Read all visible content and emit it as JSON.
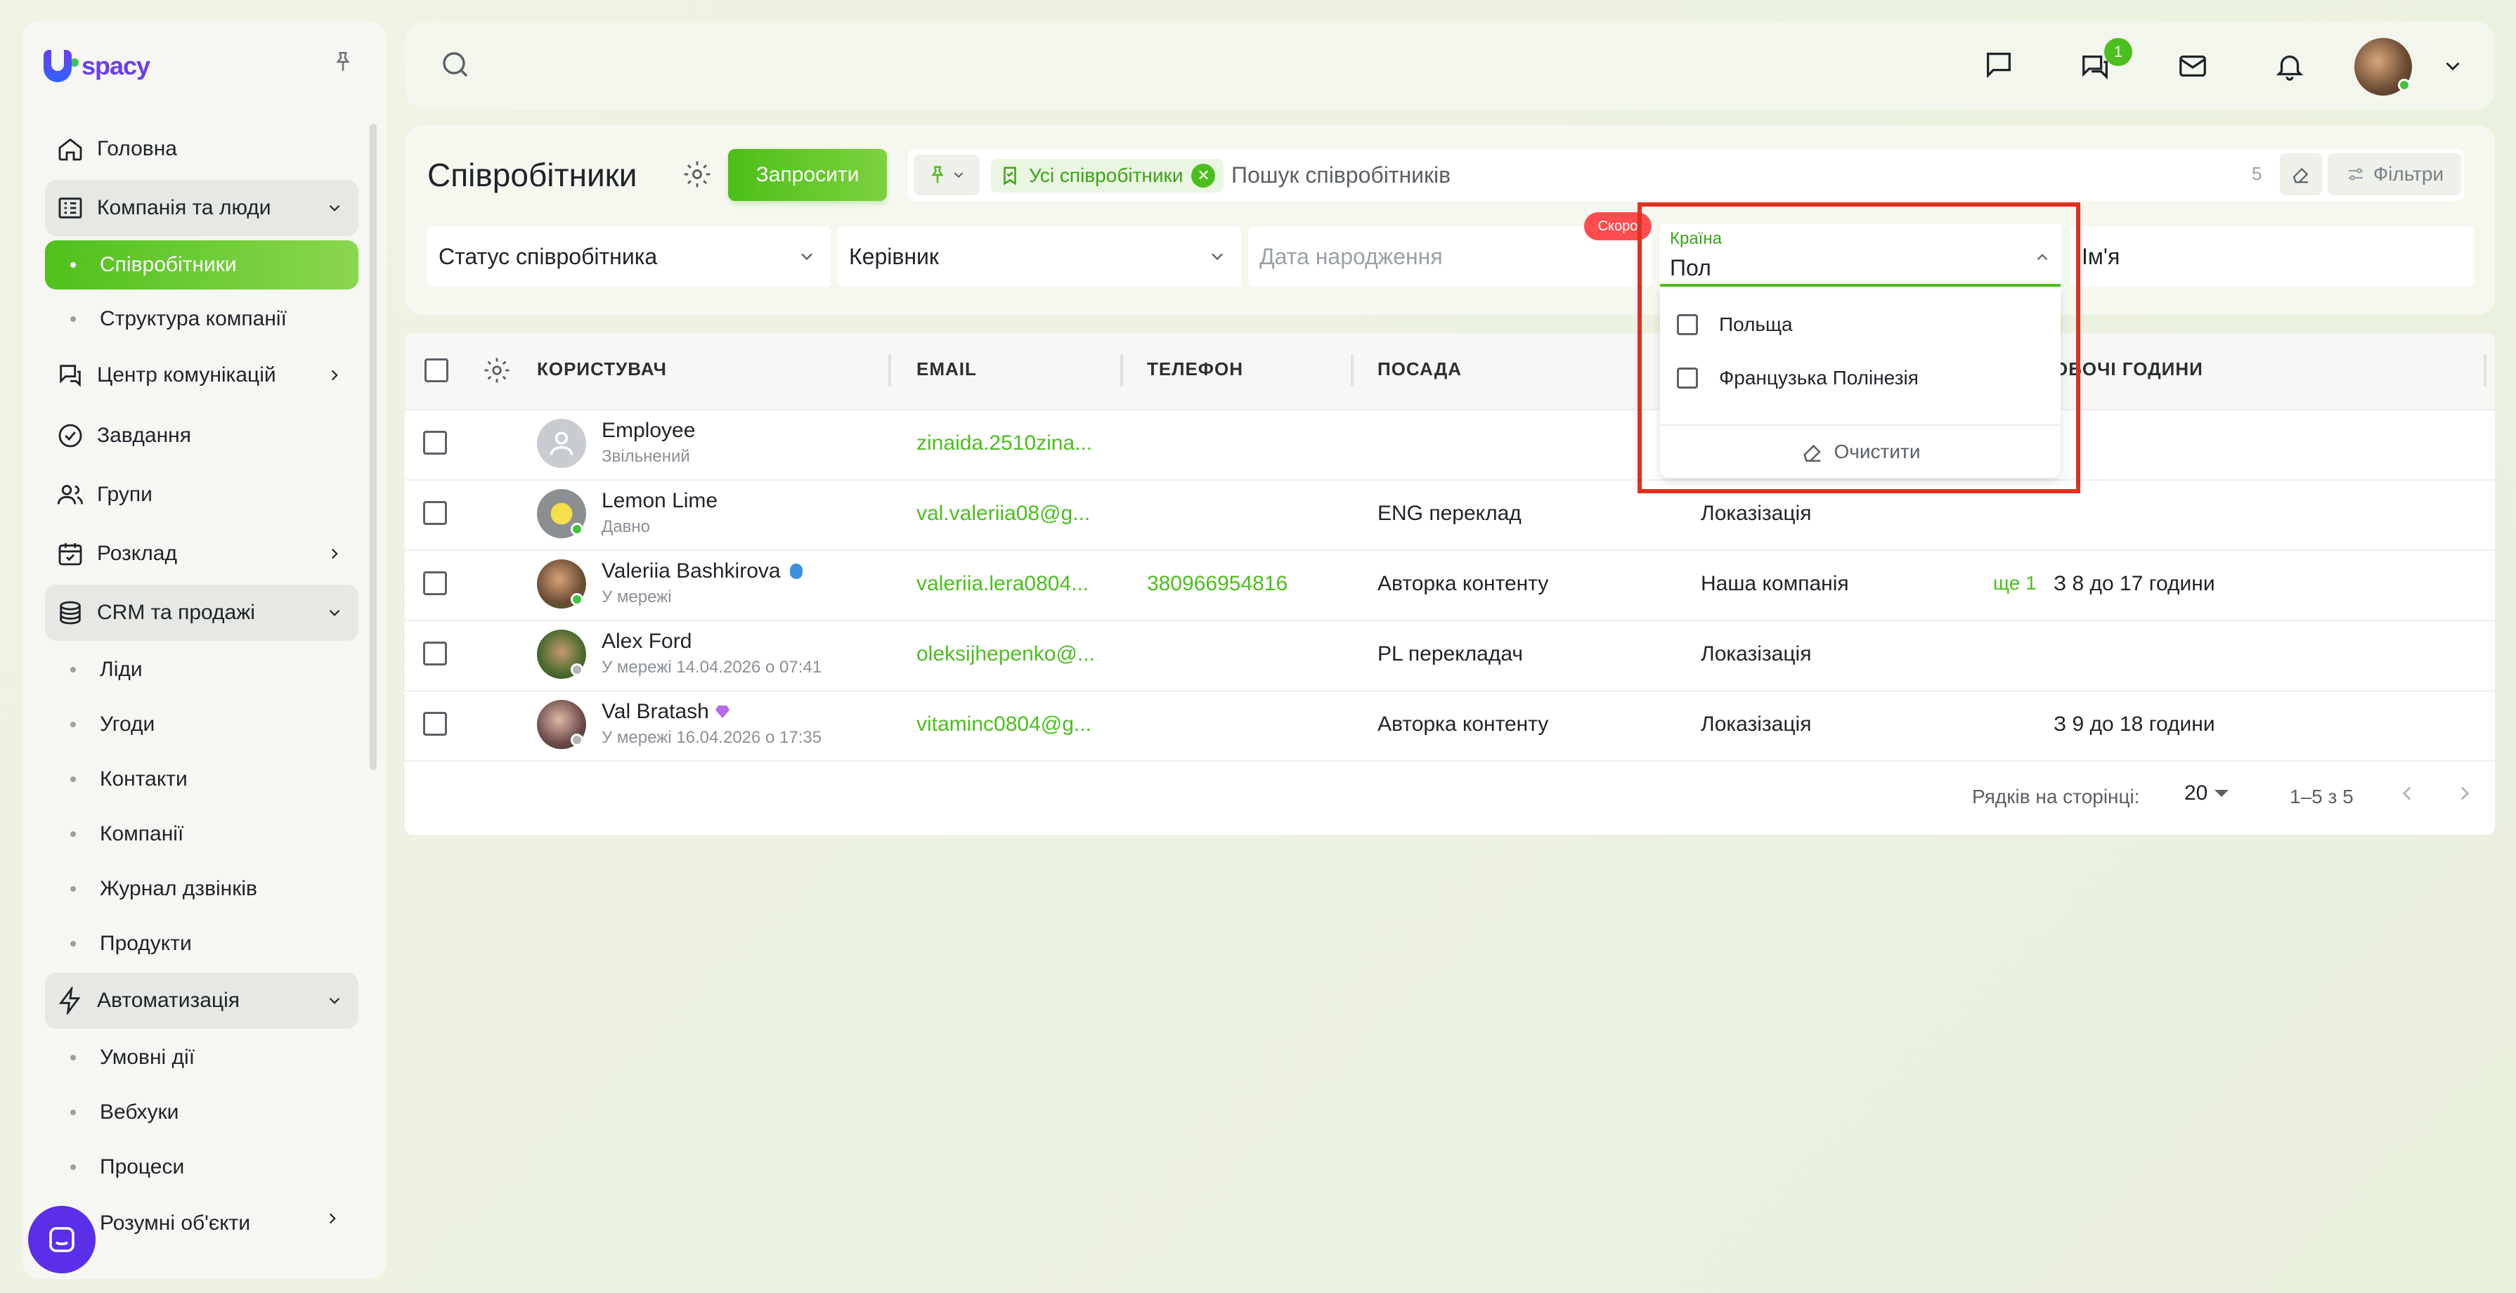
{
  "app": {
    "logo_text": "spacy"
  },
  "colors": {
    "brand_green": "#4cbe1d",
    "brand_purple": "#6a3df0",
    "highlight_red": "#e12f1f"
  },
  "sidebar": {
    "items": [
      {
        "label": "Головна",
        "icon": "home-icon"
      },
      {
        "label": "Компанія та люди",
        "icon": "company-icon",
        "expanded": true
      },
      {
        "label": "Співробітники",
        "sub": true,
        "active": true
      },
      {
        "label": "Структура компанії",
        "sub": true
      },
      {
        "label": "Центр комунікацій",
        "icon": "communication-icon"
      },
      {
        "label": "Завдання",
        "icon": "tasks-icon"
      },
      {
        "label": "Групи",
        "icon": "groups-icon"
      },
      {
        "label": "Розклад",
        "icon": "calendar-icon"
      },
      {
        "label": "CRM та продажі",
        "icon": "crm-icon",
        "expanded": true
      },
      {
        "label": "Ліди",
        "sub": true
      },
      {
        "label": "Угоди",
        "sub": true
      },
      {
        "label": "Контакти",
        "sub": true
      },
      {
        "label": "Компанії",
        "sub": true
      },
      {
        "label": "Журнал дзвінків",
        "sub": true
      },
      {
        "label": "Продукти",
        "sub": true
      },
      {
        "label": "Автоматизація",
        "icon": "automation-icon",
        "expanded": true
      },
      {
        "label": "Умовні дії",
        "sub": true
      },
      {
        "label": "Вебхуки",
        "sub": true
      },
      {
        "label": "Процеси",
        "sub": true
      },
      {
        "label": "Розумні об'єкти",
        "sub": true
      }
    ]
  },
  "topbar": {
    "chat_badge": "1"
  },
  "page": {
    "title": "Співробітники",
    "invite_label": "Запросити",
    "chip_label": "Усі співробітники",
    "search_placeholder": "Пошук співробітників",
    "result_count": "5",
    "filters_label": "Фільтри"
  },
  "filters": {
    "status": "Статус співробітника",
    "manager": "Керівник",
    "birthdate_placeholder": "Дата народження",
    "soon_badge": "Скоро",
    "country_label": "Країна",
    "country_value": "Пол",
    "name": "Ім'я"
  },
  "country_dropdown": {
    "options": [
      "Польща",
      "Французька Полінезія"
    ],
    "clear_label": "Очистити"
  },
  "table": {
    "headers": {
      "user": "КОРИСТУВАЧ",
      "email": "EMAIL",
      "phone": "ТЕЛЕФОН",
      "position": "ПОСАДА",
      "hours": "ОБОЧІ ГОДИНИ"
    },
    "rows": [
      {
        "name": "Employee",
        "status": "Звільнений",
        "email": "zinaida.2510zina...",
        "phone": "",
        "position": "",
        "department": "",
        "more": "",
        "hours": ""
      },
      {
        "name": "Lemon Lime",
        "status": "Давно",
        "email": "val.valeriia08@g...",
        "phone": "",
        "position": "ENG переклад",
        "department": "Локазізація",
        "more": "",
        "hours": ""
      },
      {
        "name": "Valeriia Bashkirova",
        "status": "У мережі",
        "email": "valeriia.lera0804...",
        "phone": "380966954816",
        "position": "Авторка контенту",
        "department": "Наша компанія",
        "more": "ще 1",
        "hours": "З 8 до 17 години"
      },
      {
        "name": "Alex Ford",
        "status": "У мережі 14.04.2026 о 07:41",
        "email": "oleksijhepenko@...",
        "phone": "",
        "position": "PL перекладач",
        "department": "Локазізація",
        "more": "",
        "hours": ""
      },
      {
        "name": "Val Bratash",
        "status": "У мережі 16.04.2026 о 17:35",
        "email": "vitaminc0804@g...",
        "phone": "",
        "position": "Авторка контенту",
        "department": "Локазізація",
        "more": "",
        "hours": "З 9 до 18 години"
      }
    ]
  },
  "pagination": {
    "rows_per_page_label": "Рядків на сторінці:",
    "rows_per_page": "20",
    "range": "1–5 з 5"
  }
}
